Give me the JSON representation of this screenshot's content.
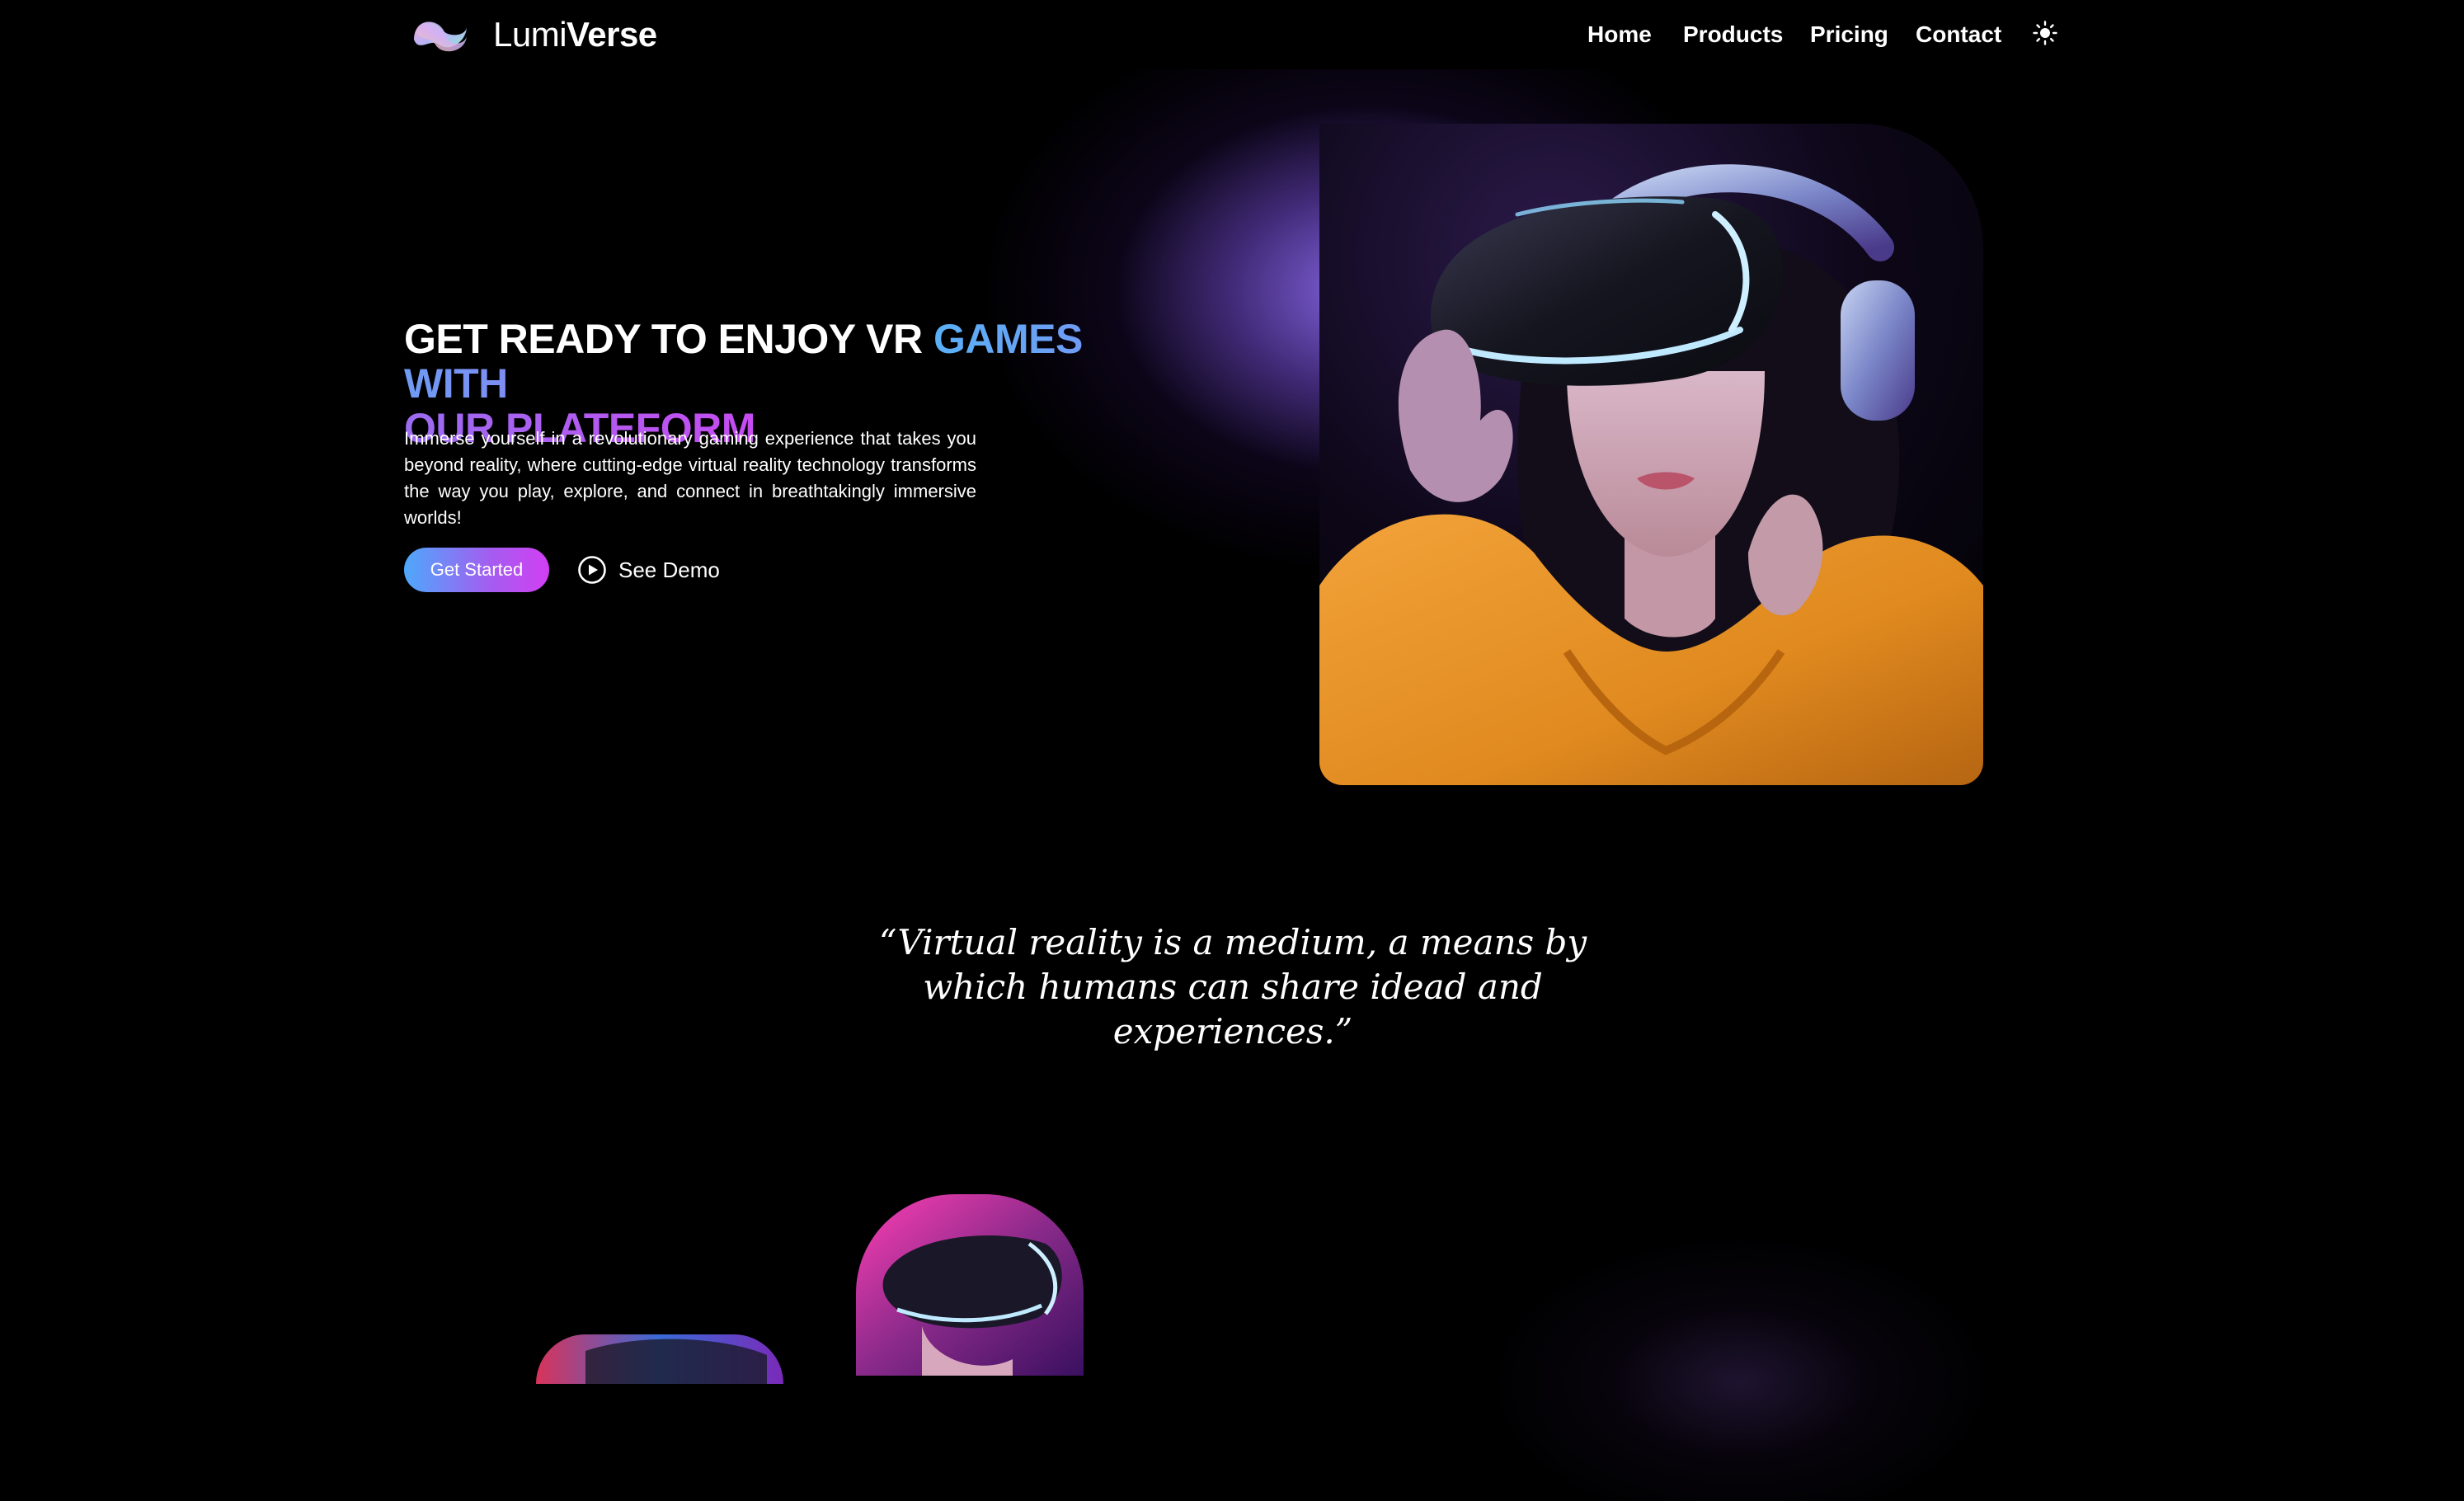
{
  "brand": {
    "name_light": "Lumi",
    "name_bold": "Verse",
    "logo_icon": "lumiverse-logo-icon"
  },
  "nav": {
    "items": [
      {
        "label": "Home"
      },
      {
        "label": "Products"
      },
      {
        "label": "Pricing"
      },
      {
        "label": "Contact"
      }
    ],
    "theme_toggle_icon": "sun-icon"
  },
  "hero": {
    "title_white": "GET READY TO ENJOY VR ",
    "title_blue": "GAMES WITH",
    "title_purple": "OUR PLATEFORM",
    "description": "Immerse yourself in a revolutionary gaming experience that takes you beyond reality, where cutting-edge virtual reality technology transforms the way you play, explore, and connect in breathtakingly immersive worlds!",
    "primary_button": "Get Started",
    "secondary_button": "See Demo",
    "secondary_icon": "play-circle-icon",
    "image": "vr-headset-woman-image"
  },
  "quote": {
    "text": "“Virtual reality is a medium, a means by which humans can share idead and experiences.”"
  },
  "colors": {
    "background": "#000000",
    "accent_blue": "#5ab0f7",
    "accent_purple": "#9a6cf0",
    "accent_magenta": "#c64bf0"
  }
}
